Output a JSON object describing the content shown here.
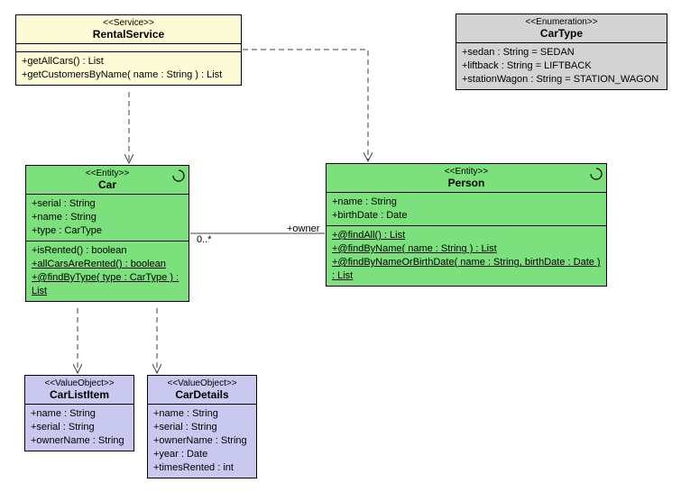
{
  "rentalService": {
    "stereo": "<<Service>>",
    "title": "RentalService",
    "ops": [
      "+getAllCars() : List",
      "+getCustomersByName( name : String ) : List"
    ]
  },
  "carType": {
    "stereo": "<<Enumeration>>",
    "title": "CarType",
    "items": [
      "+sedan : String = SEDAN",
      "+liftback : String = LIFTBACK",
      "+stationWagon : String = STATION_WAGON"
    ]
  },
  "car": {
    "stereo": "<<Entity>>",
    "title": "Car",
    "attrs": [
      "+serial : String",
      "+name : String",
      "+type : CarType"
    ],
    "ops": [
      "+isRented() : boolean",
      "+allCarsAreRented() : boolean",
      "+@findByType( type : CarType ) : List"
    ]
  },
  "person": {
    "stereo": "<<Entity>>",
    "title": "Person",
    "attrs": [
      "+name : String",
      "+birthDate : Date"
    ],
    "ops": [
      "+@findAll() : List",
      "+@findByName( name : String ) : List",
      "+@findByNameOrBirthDate( name : String, birthDate : Date ) : List"
    ]
  },
  "carListItem": {
    "stereo": "<<ValueObject>>",
    "title": "CarListItem",
    "attrs": [
      "+name : String",
      "+serial : String",
      "+ownerName : String"
    ]
  },
  "carDetails": {
    "stereo": "<<ValueObject>>",
    "title": "CarDetails",
    "attrs": [
      "+name : String",
      "+serial : String",
      "+ownerName : String",
      "+year : Date",
      "+timesRented : int"
    ]
  },
  "assoc": {
    "mult": "0..*",
    "role": "+owner"
  }
}
